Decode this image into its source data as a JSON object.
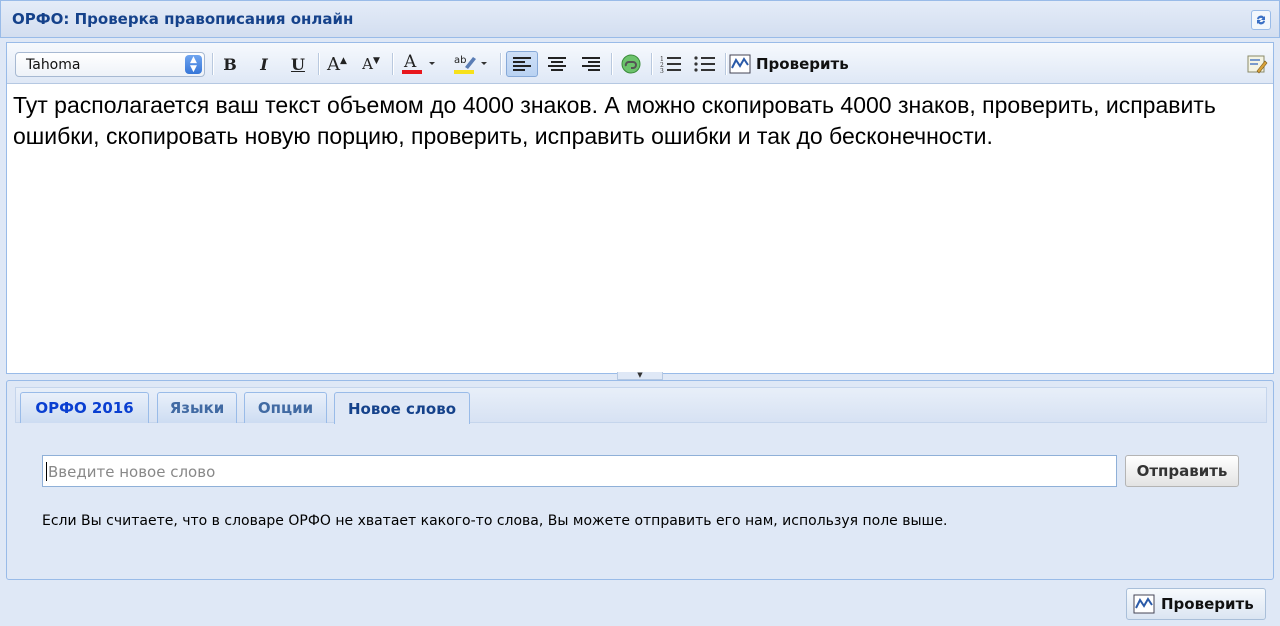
{
  "window": {
    "title": "ОРФО: Проверка правописания онлайн"
  },
  "toolbar": {
    "font_family_value": "Tahoma",
    "check_label": "Проверить",
    "font_color": "#e8171d",
    "highlight_color": "#f7e11b"
  },
  "editor": {
    "text": "Тут располагается ваш текст объемом до 4000 знаков. А можно скопировать 4000 знаков, проверить, исправить ошибки, скопировать новую порцию, проверить, исправить ошибки и так до бесконечности."
  },
  "tabs": [
    {
      "label": "ОРФО 2016"
    },
    {
      "label": "Языки"
    },
    {
      "label": "Опции"
    },
    {
      "label": "Новое слово"
    }
  ],
  "new_word": {
    "placeholder": "Введите новое слово",
    "send_label": "Отправить",
    "help_text": "Если Вы считаете, что в словаре ОРФО не хватает какого-то слова, Вы можете отправить его нам, используя поле выше."
  },
  "footer": {
    "check_label": "Проверить"
  }
}
